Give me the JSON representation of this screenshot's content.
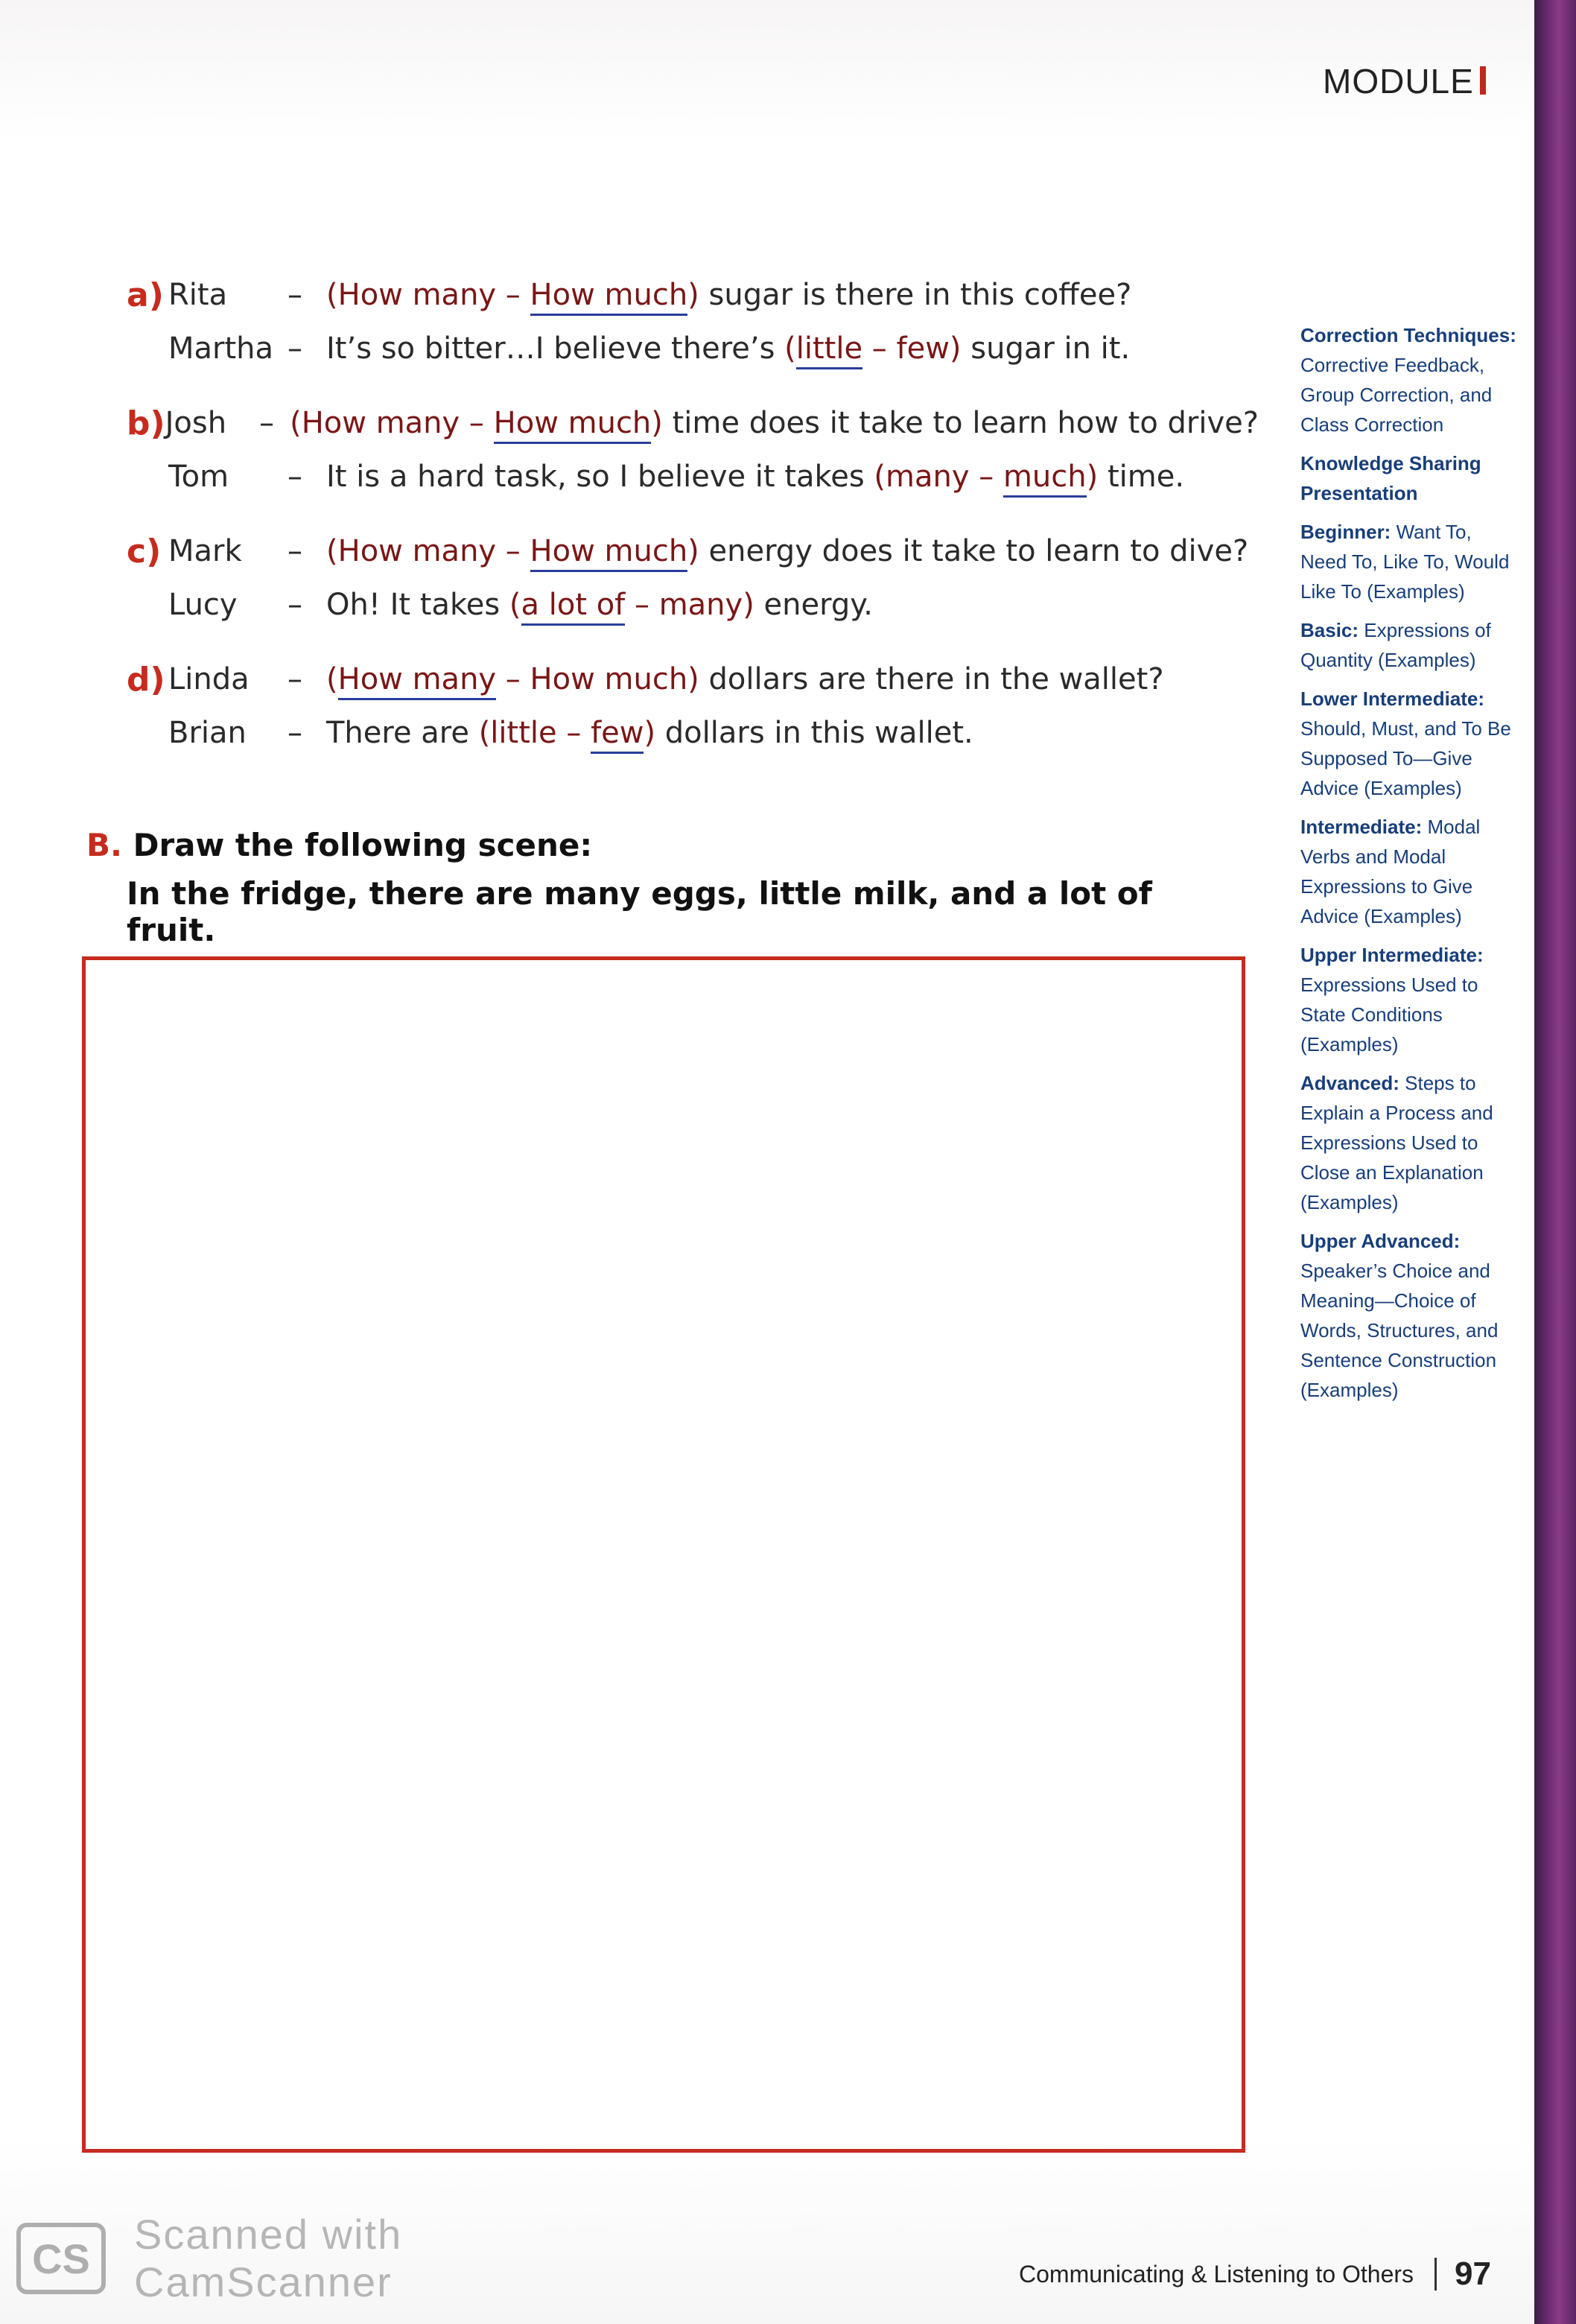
{
  "header": {
    "module_label": "MODULE"
  },
  "exercise_a": [
    {
      "letter": "a)",
      "lines": [
        {
          "speaker": "Rita",
          "dash": "–",
          "parts": [
            {
              "t": "(",
              "k": "opt"
            },
            {
              "t": "How many",
              "k": "opt"
            },
            {
              "t": " – ",
              "k": "opt"
            },
            {
              "t": "How much",
              "k": "ans"
            },
            {
              "t": ")",
              "k": "opt"
            },
            {
              "t": " sugar is there in this coffee?",
              "k": "txt"
            }
          ]
        },
        {
          "speaker": "Martha",
          "dash": "–",
          "parts": [
            {
              "t": "It’s so bitter…I believe there’s ",
              "k": "txt"
            },
            {
              "t": "(",
              "k": "opt"
            },
            {
              "t": "little",
              "k": "ans"
            },
            {
              "t": " – ",
              "k": "opt"
            },
            {
              "t": "few",
              "k": "opt"
            },
            {
              "t": ")",
              "k": "opt"
            },
            {
              "t": " sugar in it.",
              "k": "txt"
            }
          ]
        }
      ]
    },
    {
      "letter": "b)",
      "lines": [
        {
          "speaker": "Josh",
          "dash": "–",
          "parts": [
            {
              "t": "(",
              "k": "opt"
            },
            {
              "t": "How many",
              "k": "opt"
            },
            {
              "t": " – ",
              "k": "opt"
            },
            {
              "t": "How much",
              "k": "ans"
            },
            {
              "t": ")",
              "k": "opt"
            },
            {
              "t": " time does it take to learn how to drive?",
              "k": "txt"
            }
          ]
        },
        {
          "speaker": "Tom",
          "dash": "–",
          "parts": [
            {
              "t": "It is a hard task, so I believe it takes ",
              "k": "txt"
            },
            {
              "t": "(",
              "k": "opt"
            },
            {
              "t": "many",
              "k": "opt"
            },
            {
              "t": " – ",
              "k": "opt"
            },
            {
              "t": "much",
              "k": "ans"
            },
            {
              "t": ")",
              "k": "opt"
            },
            {
              "t": " time.",
              "k": "txt"
            }
          ]
        }
      ]
    },
    {
      "letter": "c)",
      "lines": [
        {
          "speaker": "Mark",
          "dash": "–",
          "parts": [
            {
              "t": "(",
              "k": "opt"
            },
            {
              "t": "How many",
              "k": "opt"
            },
            {
              "t": " – ",
              "k": "opt"
            },
            {
              "t": "How much",
              "k": "ans"
            },
            {
              "t": ")",
              "k": "opt"
            },
            {
              "t": " energy does it take to learn to dive?",
              "k": "txt"
            }
          ]
        },
        {
          "speaker": "Lucy",
          "dash": "–",
          "parts": [
            {
              "t": "Oh! It takes ",
              "k": "txt"
            },
            {
              "t": "(",
              "k": "opt"
            },
            {
              "t": "a lot of",
              "k": "ans"
            },
            {
              "t": " – ",
              "k": "opt"
            },
            {
              "t": "many",
              "k": "opt"
            },
            {
              "t": ")",
              "k": "opt"
            },
            {
              "t": " energy.",
              "k": "txt"
            }
          ]
        }
      ]
    },
    {
      "letter": "d)",
      "lines": [
        {
          "speaker": "Linda",
          "dash": "–",
          "parts": [
            {
              "t": "(",
              "k": "opt"
            },
            {
              "t": "How many",
              "k": "ans"
            },
            {
              "t": " – ",
              "k": "opt"
            },
            {
              "t": "How much",
              "k": "opt"
            },
            {
              "t": ")",
              "k": "opt"
            },
            {
              "t": " dollars are there in the wallet?",
              "k": "txt"
            }
          ]
        },
        {
          "speaker": "Brian",
          "dash": "–",
          "parts": [
            {
              "t": "There are ",
              "k": "txt"
            },
            {
              "t": "(",
              "k": "opt"
            },
            {
              "t": "little",
              "k": "opt"
            },
            {
              "t": " – ",
              "k": "opt"
            },
            {
              "t": "few",
              "k": "ans"
            },
            {
              "t": ")",
              "k": "opt"
            },
            {
              "t": " dollars in this wallet.",
              "k": "txt"
            }
          ]
        }
      ]
    }
  ],
  "section_b": {
    "label": "B.",
    "title": "Draw the following scene:",
    "instruction": "In the fridge, there are many eggs, little milk, and a lot of fruit."
  },
  "sidebar": [
    {
      "bold": "Correction Techniques:",
      "rest": " Corrective Feedback, Group Correction, and Class Correction"
    },
    {
      "bold": "Knowledge Sharing Presentation",
      "rest": ""
    },
    {
      "bold": "Beginner:",
      "rest": " Want To, Need To, Like To, Would Like To (Examples)"
    },
    {
      "bold": "Basic:",
      "rest": " Expressions of Quantity (Examples)"
    },
    {
      "bold": "Lower Intermediate:",
      "rest": " Should, Must, and To Be Supposed To—Give Advice (Examples)"
    },
    {
      "bold": "Intermediate:",
      "rest": " Modal Verbs and Modal Expressions to Give Advice (Examples)"
    },
    {
      "bold": "Upper Intermediate:",
      "rest": " Expressions Used to State Conditions (Examples)"
    },
    {
      "bold": "Advanced:",
      "rest": " Steps to Explain a Process and Expressions Used to Close an Explanation (Examples)"
    },
    {
      "bold": "Upper Advanced:",
      "rest": " Speaker’s Choice and Meaning—Choice of Words, Structures, and Sentence Construction (Examples)"
    }
  ],
  "footer": {
    "section": "Communicating & Listening to Others",
    "page": "97"
  },
  "watermark": {
    "logo": "CS",
    "line1": "Scanned with",
    "line2": "CamScanner"
  },
  "colors": {
    "accent_red": "#c62b1e",
    "answer_underline": "#2a3d9a",
    "sidebar_blue": "#173e7a",
    "spine_purple": "#6b2c73"
  }
}
